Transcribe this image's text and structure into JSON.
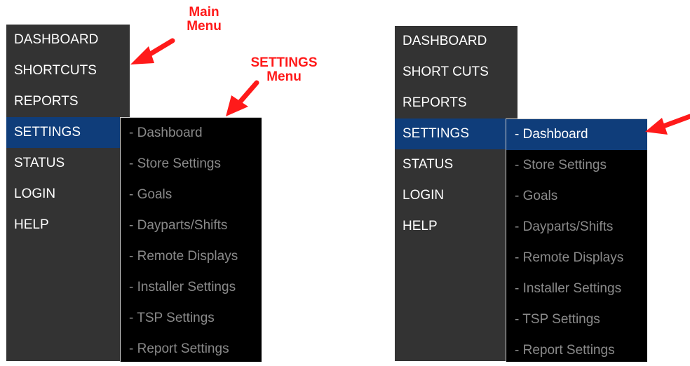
{
  "left_panel": {
    "main_menu": [
      {
        "label": "DASHBOARD"
      },
      {
        "label": "SHORTCUTS"
      },
      {
        "label": "REPORTS"
      },
      {
        "label": "SETTINGS",
        "active": true
      },
      {
        "label": "STATUS"
      },
      {
        "label": "LOGIN"
      },
      {
        "label": "HELP"
      }
    ],
    "settings_menu": [
      {
        "label": "- Dashboard"
      },
      {
        "label": "- Store Settings"
      },
      {
        "label": "- Goals"
      },
      {
        "label": "- Dayparts/Shifts"
      },
      {
        "label": "- Remote Displays"
      },
      {
        "label": "- Installer Settings"
      },
      {
        "label": "- TSP Settings"
      },
      {
        "label": "- Report Settings"
      }
    ]
  },
  "right_panel": {
    "main_menu": [
      {
        "label": "DASHBOARD"
      },
      {
        "label": "SHORT CUTS"
      },
      {
        "label": "REPORTS"
      },
      {
        "label": "SETTINGS",
        "active": true
      },
      {
        "label": "STATUS"
      },
      {
        "label": "LOGIN"
      },
      {
        "label": "HELP"
      }
    ],
    "settings_menu": [
      {
        "label": "- Dashboard",
        "highlighted": true
      },
      {
        "label": "- Store Settings"
      },
      {
        "label": "- Goals"
      },
      {
        "label": "- Dayparts/Shifts"
      },
      {
        "label": "- Remote Displays"
      },
      {
        "label": "- Installer Settings"
      },
      {
        "label": "- TSP Settings"
      },
      {
        "label": "- Report Settings"
      }
    ]
  },
  "annotations": {
    "main_menu_label_line1": "Main",
    "main_menu_label_line2": "Menu",
    "settings_menu_label_line1": "SETTINGS",
    "settings_menu_label_line2": "Menu"
  },
  "colors": {
    "main_menu_bg": "#333333",
    "submenu_bg": "#000000",
    "active_bg": "#0f3d7a",
    "annotation": "#ff1a1a"
  }
}
